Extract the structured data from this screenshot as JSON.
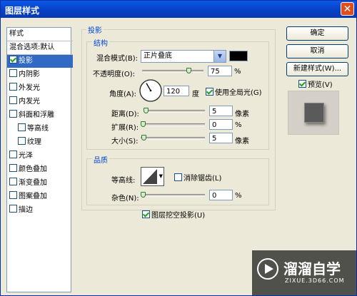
{
  "window": {
    "title": "图层样式",
    "close": "✕"
  },
  "left_panel": {
    "header": "样式",
    "blend_options": "混合选项:默认",
    "items": [
      {
        "label": "投影",
        "checked": true,
        "selected": true
      },
      {
        "label": "内阴影",
        "checked": false
      },
      {
        "label": "外发光",
        "checked": false
      },
      {
        "label": "内发光",
        "checked": false
      },
      {
        "label": "斜面和浮雕",
        "checked": false
      },
      {
        "label": "等高线",
        "checked": false,
        "sub": true
      },
      {
        "label": "纹理",
        "checked": false,
        "sub": true
      },
      {
        "label": "光泽",
        "checked": false
      },
      {
        "label": "颜色叠加",
        "checked": false
      },
      {
        "label": "渐变叠加",
        "checked": false
      },
      {
        "label": "图案叠加",
        "checked": false
      },
      {
        "label": "描边",
        "checked": false
      }
    ]
  },
  "shadow": {
    "title": "投影",
    "structure": {
      "title": "结构",
      "blend_mode_label": "混合模式(B):",
      "blend_mode_value": "正片叠底",
      "shadow_color": "#000000",
      "opacity_label": "不透明度(O):",
      "opacity_value": "75",
      "opacity_unit": "%",
      "opacity_fraction": 0.75,
      "angle_label": "角度(A):",
      "angle_value": "120",
      "angle_unit": "度",
      "global_light_label": "使用全局光(G)",
      "global_light_checked": true,
      "distance_label": "距离(D):",
      "distance_value": "5",
      "distance_unit": "像素",
      "spread_label": "扩展(R):",
      "spread_value": "0",
      "spread_unit": "%",
      "size_label": "大小(S):",
      "size_value": "5",
      "size_unit": "像素"
    },
    "quality": {
      "title": "品质",
      "contour_label": "等高线:",
      "antialias_label": "消除锯齿(L)",
      "antialias_checked": false,
      "noise_label": "杂色(N):",
      "noise_value": "0",
      "noise_unit": "%"
    },
    "knockout_label": "图层挖空投影(U)",
    "knockout_checked": true
  },
  "buttons": {
    "ok": "确定",
    "cancel": "取消",
    "new_style": "新建样式(W)...",
    "preview_label": "预览(V)",
    "preview_checked": true
  },
  "watermark": {
    "brand": "溜溜自学",
    "url": "ZIXUE.3D66.COM"
  }
}
